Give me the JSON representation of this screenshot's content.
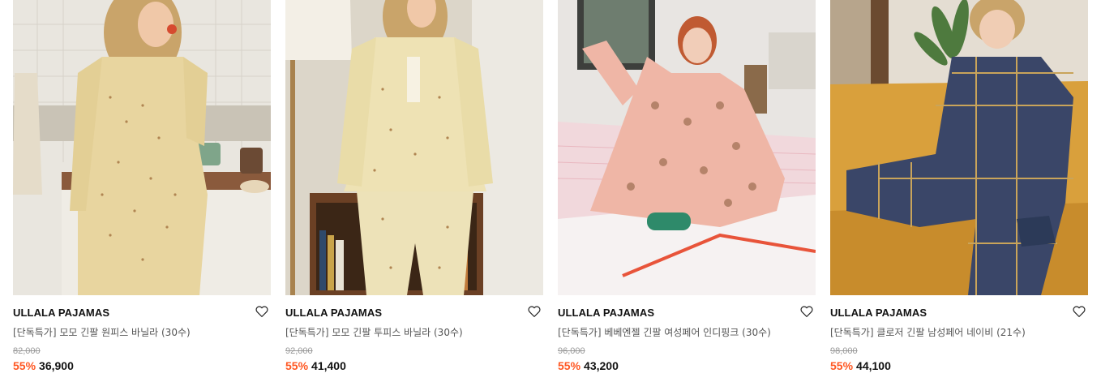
{
  "products": [
    {
      "brand": "ULLALA PAJAMAS",
      "name": "[단독특가] 모모 긴팔 원피스 바닐라 (30수)",
      "original_price": "82,000",
      "discount": "55%",
      "sale_price": "36,900",
      "wishlist_icon": "heart-outline-icon"
    },
    {
      "brand": "ULLALA PAJAMAS",
      "name": "[단독특가] 모모 긴팔 투피스 바닐라 (30수)",
      "original_price": "92,000",
      "discount": "55%",
      "sale_price": "41,400",
      "wishlist_icon": "heart-outline-icon"
    },
    {
      "brand": "ULLALA PAJAMAS",
      "name": "[단독특가] 베베엔젤 긴팔 여성페어 인디핑크 (30수)",
      "original_price": "96,000",
      "discount": "55%",
      "sale_price": "43,200",
      "wishlist_icon": "heart-outline-icon"
    },
    {
      "brand": "ULLALA PAJAMAS",
      "name": "[단독특가] 클로저 긴팔 남성페어 네이비 (21수)",
      "original_price": "98,000",
      "discount": "55%",
      "sale_price": "44,100",
      "wishlist_icon": "heart-outline-icon"
    }
  ],
  "colors": {
    "discount": "#ff5722",
    "brand_text": "#111111",
    "name_text": "#555555",
    "original_price_text": "#9a9a9a"
  }
}
